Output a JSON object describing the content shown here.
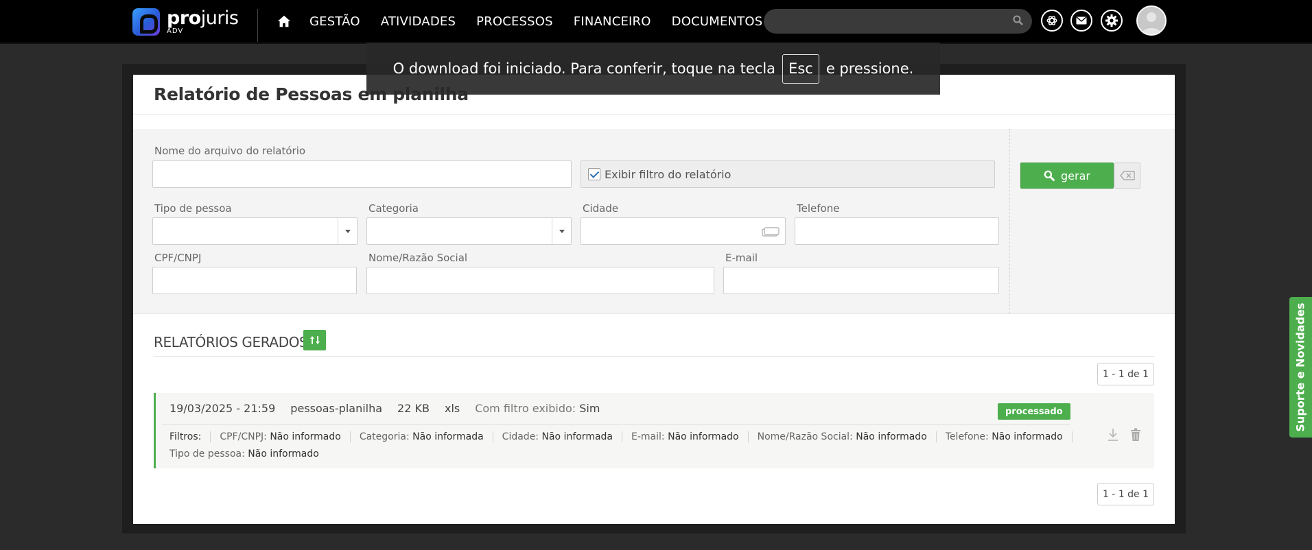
{
  "app": {
    "logo_name_bold": "pro",
    "logo_name_rest": "juris",
    "logo_sub": "ADV"
  },
  "nav": {
    "items": [
      "GESTÃO",
      "ATIVIDADES",
      "PROCESSOS",
      "FINANCEIRO",
      "DOCUMENTOS"
    ],
    "search_placeholder": ""
  },
  "toast": {
    "text_before": "O download foi iniciado. Para conferir, toque na tecla",
    "key": "Esc",
    "text_after": "e pressione."
  },
  "page": {
    "title": "Relatório de Pessoas em planilha"
  },
  "form": {
    "file_name_label": "Nome do arquivo do relatório",
    "file_name_value": "",
    "show_filter_label": "Exibir filtro do relatório",
    "show_filter_checked": true,
    "person_type_label": "Tipo de pessoa",
    "category_label": "Categoria",
    "city_label": "Cidade",
    "phone_label": "Telefone",
    "cpf_label": "CPF/CNPJ",
    "name_label": "Nome/Razão Social",
    "email_label": "E-mail",
    "generate_button": "gerar"
  },
  "reports": {
    "section_title": "RELATÓRIOS GERADOS",
    "pager_top": "1 - 1 de 1",
    "pager_bottom": "1 - 1 de 1",
    "items": [
      {
        "datetime": "19/03/2025 - 21:59",
        "name": "pessoas-planilha",
        "size": "22 KB",
        "ext": "xls",
        "filter_shown_label": "Com filtro exibido:",
        "filter_shown_value": "Sim",
        "status": "processado",
        "filters_title": "Filtros:",
        "filters": [
          {
            "label": "CPF/CNPJ:",
            "value": "Não informado"
          },
          {
            "label": "Categoria:",
            "value": "Não informada"
          },
          {
            "label": "Cidade:",
            "value": "Não informada"
          },
          {
            "label": "E-mail:",
            "value": "Não informado"
          },
          {
            "label": "Nome/Razão Social:",
            "value": "Não informado"
          },
          {
            "label": "Telefone:",
            "value": "Não informado"
          }
        ],
        "filter_extra": {
          "label": "Tipo de pessoa:",
          "value": "Não informado"
        }
      }
    ]
  },
  "side_tab": {
    "label": "Suporte e Novidades"
  },
  "colors": {
    "accent_green": "#4cae4c",
    "topbar": "#000000",
    "background": "#2b2b2b"
  }
}
